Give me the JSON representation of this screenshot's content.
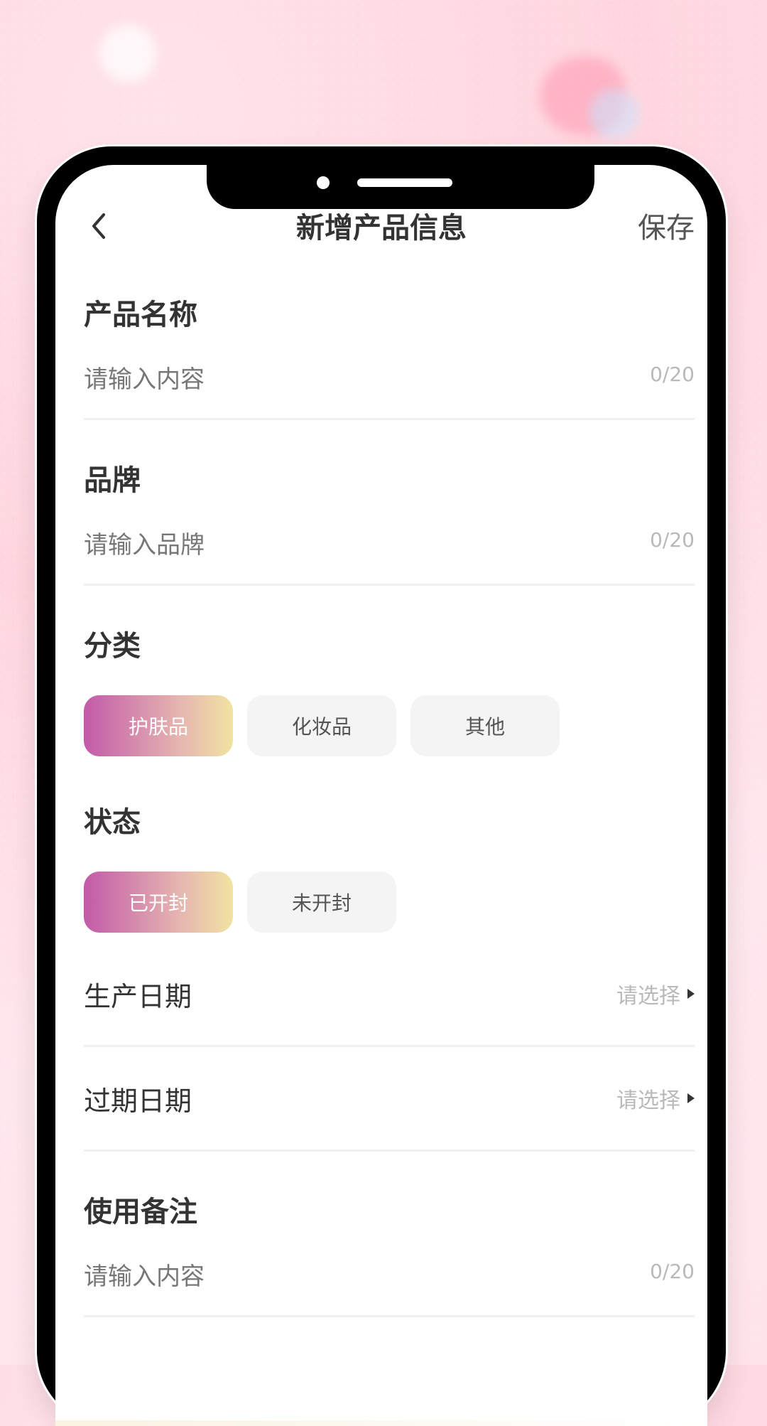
{
  "header": {
    "title": "新增产品信息",
    "save_label": "保存"
  },
  "sections": {
    "product_name": {
      "title": "产品名称",
      "placeholder": "请输入内容",
      "counter": "0/20"
    },
    "brand": {
      "title": "品牌",
      "placeholder": "请输入品牌",
      "counter": "0/20"
    },
    "category": {
      "title": "分类",
      "options": [
        "护肤品",
        "化妆品",
        "其他"
      ],
      "selected": "护肤品"
    },
    "status": {
      "title": "状态",
      "options": [
        "已开封",
        "未开封"
      ],
      "selected": "已开封"
    },
    "production_date": {
      "label": "生产日期",
      "value": "请选择"
    },
    "expiry_date": {
      "label": "过期日期",
      "value": "请选择"
    },
    "usage_notes": {
      "title": "使用备注",
      "placeholder": "请输入内容",
      "counter": "0/20"
    }
  },
  "colors": {
    "accent_gradient_start": "#c25aa8",
    "accent_gradient_end": "#f1e3a2",
    "chip_inactive": "#f4f4f4",
    "divider": "#f0f0f0"
  },
  "icons": {
    "back": "chevron-left-icon",
    "picker_arrow": "triangle-right-icon"
  }
}
